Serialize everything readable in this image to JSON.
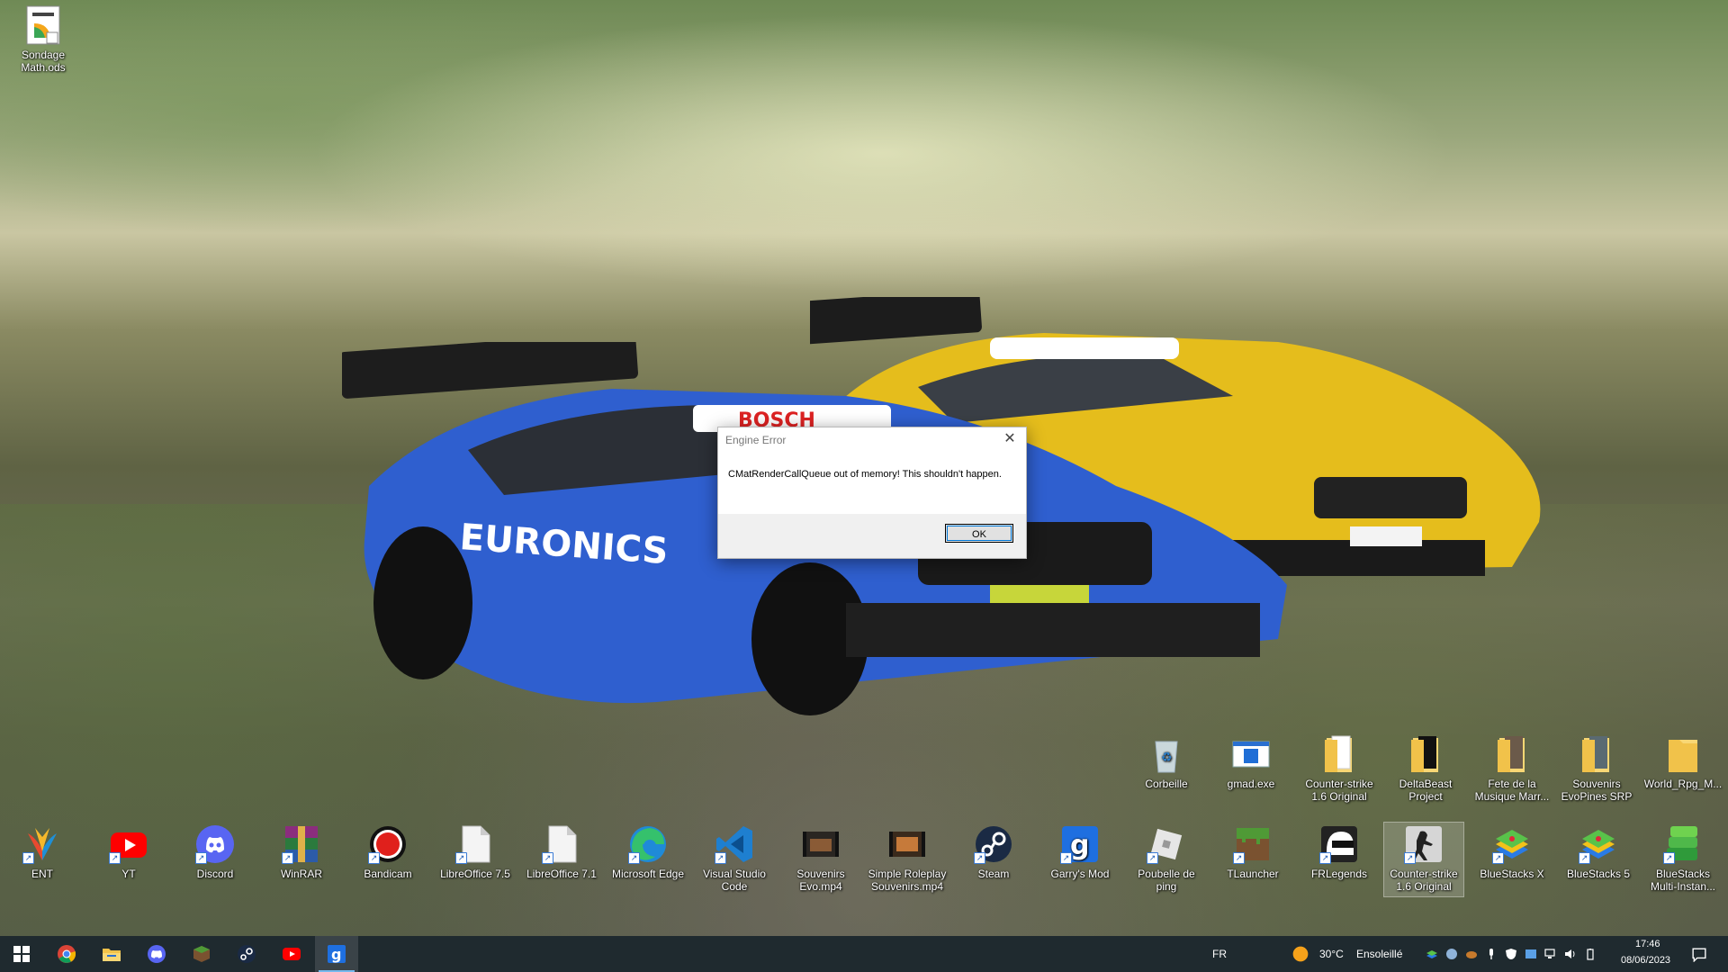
{
  "desktop": {
    "icons_top_left": [
      {
        "label": "Sondage Math.ods",
        "icon": "spreadsheet-file-icon"
      }
    ],
    "icons_row_upper": [
      {
        "label": "Corbeille",
        "icon": "recycle-bin-icon"
      },
      {
        "label": "gmad.exe",
        "icon": "exe-window-icon"
      },
      {
        "label": "Counter-strike 1.6 Original",
        "icon": "folder-icon"
      },
      {
        "label": "DeltaBeast Project",
        "icon": "folder-icon"
      },
      {
        "label": "Fete de la Musique Marr...",
        "icon": "folder-icon"
      },
      {
        "label": "Souvenirs EvoPines SRP",
        "icon": "folder-icon"
      },
      {
        "label": "World_Rpg_M...",
        "icon": "folder-icon"
      }
    ],
    "icons_row_lower": [
      {
        "label": "ENT",
        "icon": "ent-icon"
      },
      {
        "label": "YT",
        "icon": "youtube-icon"
      },
      {
        "label": "Discord",
        "icon": "discord-icon"
      },
      {
        "label": "WinRAR",
        "icon": "winrar-icon"
      },
      {
        "label": "Bandicam",
        "icon": "bandicam-icon"
      },
      {
        "label": "LibreOffice 7.5",
        "icon": "document-icon"
      },
      {
        "label": "LibreOffice 7.1",
        "icon": "document-icon"
      },
      {
        "label": "Microsoft Edge",
        "icon": "edge-icon"
      },
      {
        "label": "Visual Studio Code",
        "icon": "vscode-icon"
      },
      {
        "label": "Souvenirs Evo.mp4",
        "icon": "video-thumbnail-icon"
      },
      {
        "label": "Simple Roleplay Souvenirs.mp4",
        "icon": "video-thumbnail-icon"
      },
      {
        "label": "Steam",
        "icon": "steam-icon"
      },
      {
        "label": "Garry's Mod",
        "icon": "garrys-mod-icon"
      },
      {
        "label": "Poubelle de ping",
        "icon": "roblox-icon"
      },
      {
        "label": "TLauncher",
        "icon": "grass-block-icon"
      },
      {
        "label": "FRLegends",
        "icon": "helmet-icon"
      },
      {
        "label": "Counter-strike 1.6 Original",
        "icon": "counter-strike-icon",
        "selected": true
      },
      {
        "label": "BlueStacks X",
        "icon": "bluestacks-icon"
      },
      {
        "label": "BlueStacks 5",
        "icon": "bluestacks-icon"
      },
      {
        "label": "BlueStacks Multi-Instan...",
        "icon": "bluestacks-multi-icon"
      }
    ]
  },
  "dialog": {
    "title": "Engine Error",
    "message": "CMatRenderCallQueue out of memory! This shouldn't happen.",
    "ok_label": "OK",
    "close_glyph": "✕"
  },
  "taskbar": {
    "pinned": [
      {
        "name": "start-button",
        "icon": "windows-logo-icon"
      },
      {
        "name": "chrome",
        "icon": "chrome-icon"
      },
      {
        "name": "file-explorer",
        "icon": "folder-icon"
      },
      {
        "name": "discord",
        "icon": "discord-icon"
      },
      {
        "name": "minecraft",
        "icon": "grass-block-icon"
      },
      {
        "name": "steam",
        "icon": "steam-icon"
      },
      {
        "name": "youtube",
        "icon": "youtube-icon"
      },
      {
        "name": "garrys-mod",
        "icon": "garrys-mod-icon",
        "active": true
      }
    ],
    "language": "FR",
    "weather_temp": "30°C",
    "weather_desc": "Ensoleillé",
    "time": "17:46",
    "date": "08/06/2023"
  },
  "colors": {
    "taskbar_bg": "#1f2a2f",
    "accent": "#0078d7",
    "active_indicator": "#76b9ed"
  }
}
